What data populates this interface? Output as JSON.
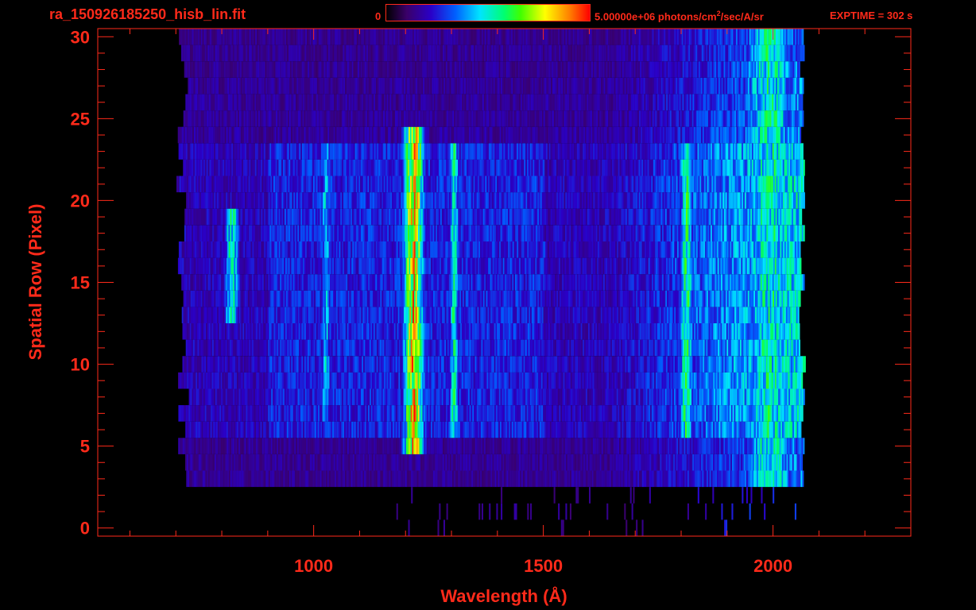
{
  "header": {
    "file_title": "ra_150926185250_hisb_lin.fit",
    "colorbar_min": "0",
    "colorbar_max": "5.00000e+06 photons/cm",
    "colorbar_unit_sup": "2",
    "colorbar_unit_rest": "/sec/A/sr",
    "exptime": "EXPTIME = 302 s"
  },
  "colors": {
    "axis": "#ff2a1a",
    "background": "#000000"
  },
  "chart_data": {
    "type": "heatmap",
    "xlabel": "Wavelength (Å)",
    "ylabel": "Spatial Row (Pixel)",
    "xlim": [
      530,
      2300
    ],
    "ylim": [
      -0.5,
      30.5
    ],
    "x_ticks": [
      1000,
      1500,
      2000
    ],
    "y_ticks": [
      0,
      5,
      10,
      15,
      20,
      25,
      30
    ],
    "colorscale": {
      "min": 0,
      "max": 5000000,
      "unit": "photons/cm2/sec/A/sr"
    },
    "data_extent": {
      "x": [
        690,
        2070
      ],
      "rows": [
        0,
        30
      ]
    },
    "emission_features": [
      {
        "center": 1216,
        "width": 45,
        "rows": [
          5,
          24.8
        ],
        "level": 0.78
      },
      {
        "center": 1304,
        "width": 22,
        "rows": [
          6,
          23
        ],
        "level": 0.5
      },
      {
        "center": 1025,
        "width": 22,
        "rows": [
          7,
          23
        ],
        "level": 0.42
      },
      {
        "center": 820,
        "width": 35,
        "rows": [
          13,
          19
        ],
        "level": 0.5
      },
      {
        "center": 1810,
        "width": 30,
        "rows": [
          5.5,
          23
        ],
        "level": 0.55
      },
      {
        "center": 1990,
        "width": 130,
        "rows": [
          3,
          30
        ],
        "level": 0.5
      }
    ]
  }
}
